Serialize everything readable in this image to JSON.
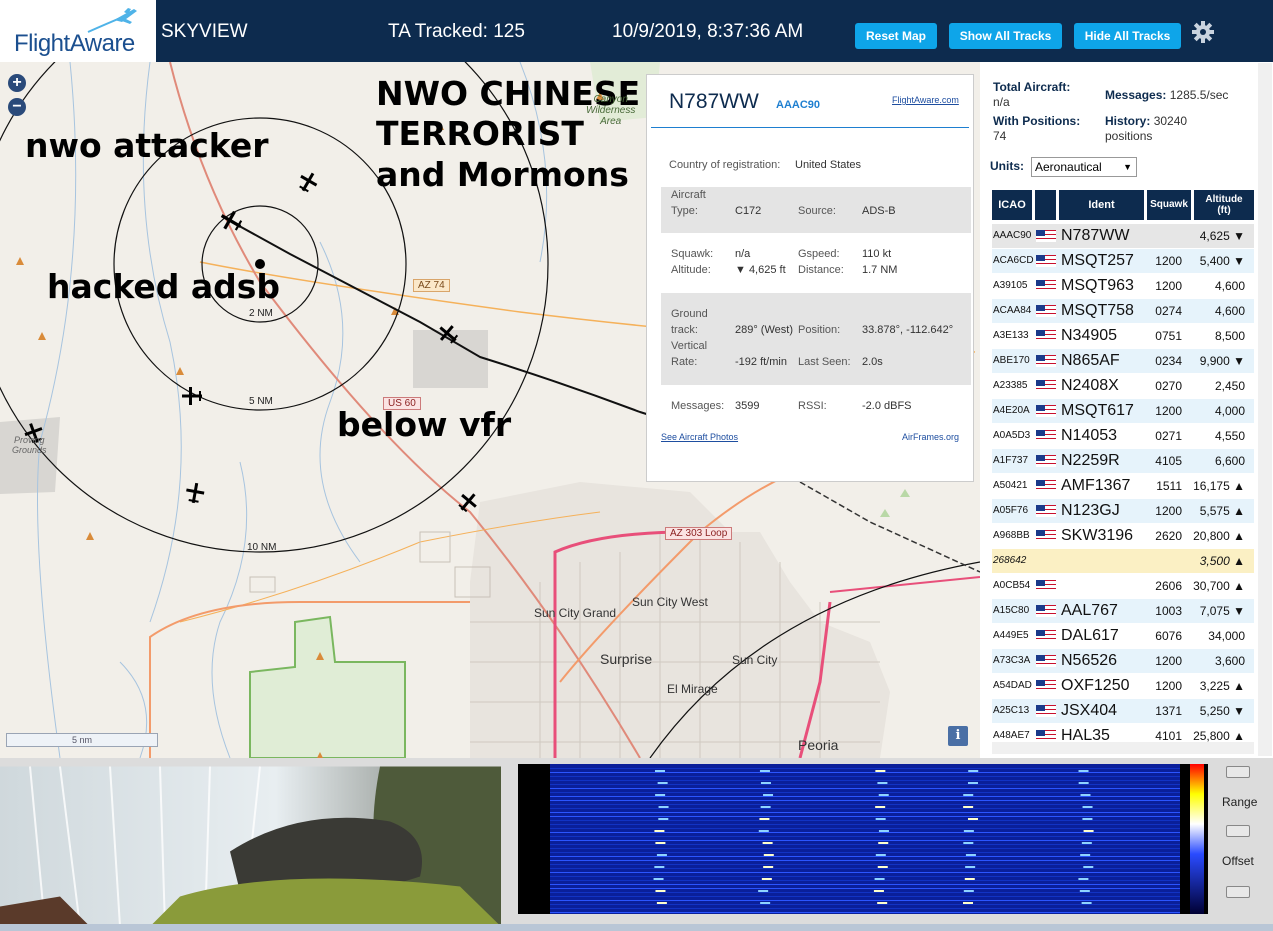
{
  "header": {
    "logo": "FlightAware",
    "title": "SKYVIEW",
    "tracked": "TA Tracked: 125",
    "datetime": "10/9/2019, 8:37:36 AM",
    "buttons": {
      "reset": "Reset Map",
      "show": "Show All Tracks",
      "hide": "Hide All Tracks"
    }
  },
  "map": {
    "zoom_in": "+",
    "zoom_out": "−",
    "annotations": {
      "attacker": "nwo attacker",
      "terrorist": "NWO CHINESE\nTERRORIST\nand Mormons",
      "hacked": "hacked adsb",
      "below": "below vfr"
    },
    "rings": [
      "2 NM",
      "5 NM",
      "10 NM"
    ],
    "places": {
      "wilderness": "Canyon\nWilderness\nArea",
      "proving": "Proving\nGrounds",
      "sun_city_grand": "Sun City Grand",
      "sun_city_west": "Sun City West",
      "surprise": "Surprise",
      "sun_city": "Sun City",
      "el_mirage": "El Mirage",
      "peoria": "Peoria"
    },
    "roads": {
      "az74": "AZ 74",
      "us60": "US 60",
      "az303": "AZ 303 Loop"
    },
    "scale": "5 nm",
    "info": "i"
  },
  "popup": {
    "registration": "N787WW",
    "icao": "AAAC90",
    "link": "FlightAware.com",
    "country_label": "Country of registration:",
    "country": "United States",
    "aircraft_label": "Aircraft",
    "type_label": "Type:",
    "type": "C172",
    "source_label": "Source:",
    "source": "ADS-B",
    "squawk_label": "Squawk:",
    "squawk": "n/a",
    "gspeed_label": "Gspeed:",
    "gspeed": "110 kt",
    "altitude_label": "Altitude:",
    "altitude": "▼ 4,625 ft",
    "distance_label": "Distance:",
    "distance": "1.7 NM",
    "ground_label": "Ground",
    "track_label": "track:",
    "track": "289° (West)",
    "position_label": "Position:",
    "position": "33.878°, -112.642°",
    "vertical_label": "Vertical",
    "rate_label": "Rate:",
    "rate": "-192 ft/min",
    "lastseen_label": "Last Seen:",
    "lastseen": "2.0s",
    "messages_label": "Messages:",
    "messages": "3599",
    "rssi_label": "RSSI:",
    "rssi": "-2.0 dBFS",
    "photos": "See Aircraft Photos",
    "airframes": "AirFrames.org"
  },
  "panel": {
    "total_label": "Total Aircraft:",
    "total": "n/a",
    "messages_label": "Messages:",
    "messages": "1285.5/sec",
    "withpos_label": "With Positions:",
    "withpos": "74",
    "history_label": "History:",
    "history": "30240",
    "history_unit": "positions",
    "units_label": "Units:",
    "units": "Aeronautical",
    "columns": {
      "icao": "ICAO",
      "ident": "Ident",
      "squawk": "Squawk",
      "alt1": "Altitude",
      "alt2": "(ft)"
    },
    "rows": [
      {
        "icao": "AAAC90",
        "ident": "N787WW",
        "squawk": "",
        "alt": "4,625 ▼",
        "flag": true
      },
      {
        "icao": "ACA6CD",
        "ident": "MSQT257",
        "squawk": "1200",
        "alt": "5,400 ▼",
        "flag": true
      },
      {
        "icao": "A39105",
        "ident": "MSQT963",
        "squawk": "1200",
        "alt": "4,600",
        "flag": true
      },
      {
        "icao": "ACAA84",
        "ident": "MSQT758",
        "squawk": "0274",
        "alt": "4,600",
        "flag": true
      },
      {
        "icao": "A3E133",
        "ident": "N34905",
        "squawk": "0751",
        "alt": "8,500",
        "flag": true
      },
      {
        "icao": "ABE170",
        "ident": "N865AF",
        "squawk": "0234",
        "alt": "9,900 ▼",
        "flag": true
      },
      {
        "icao": "A23385",
        "ident": "N2408X",
        "squawk": "0270",
        "alt": "2,450",
        "flag": true
      },
      {
        "icao": "A4E20A",
        "ident": "MSQT617",
        "squawk": "1200",
        "alt": "4,000",
        "flag": true
      },
      {
        "icao": "A0A5D3",
        "ident": "N14053",
        "squawk": "0271",
        "alt": "4,550",
        "flag": true
      },
      {
        "icao": "A1F737",
        "ident": "N2259R",
        "squawk": "4105",
        "alt": "6,600",
        "flag": true
      },
      {
        "icao": "A50421",
        "ident": "AMF1367",
        "squawk": "1511",
        "alt": "16,175 ▲",
        "flag": true
      },
      {
        "icao": "A05F76",
        "ident": "N123GJ",
        "squawk": "1200",
        "alt": "5,575 ▲",
        "flag": true
      },
      {
        "icao": "A968BB",
        "ident": "SKW3196",
        "squawk": "2620",
        "alt": "20,800 ▲",
        "flag": true
      },
      {
        "icao": "268642",
        "ident": "",
        "squawk": "",
        "alt": "3,500 ▲",
        "flag": false
      },
      {
        "icao": "A0CB54",
        "ident": "",
        "squawk": "2606",
        "alt": "30,700 ▲",
        "flag": true
      },
      {
        "icao": "A15C80",
        "ident": "AAL767",
        "squawk": "1003",
        "alt": "7,075 ▼",
        "flag": true
      },
      {
        "icao": "A449E5",
        "ident": "DAL617",
        "squawk": "6076",
        "alt": "34,000",
        "flag": true
      },
      {
        "icao": "A73C3A",
        "ident": "N56526",
        "squawk": "1200",
        "alt": "3,600",
        "flag": true
      },
      {
        "icao": "A54DAD",
        "ident": "OXF1250",
        "squawk": "1200",
        "alt": "3,225 ▲",
        "flag": true
      },
      {
        "icao": "A25C13",
        "ident": "JSX404",
        "squawk": "1371",
        "alt": "5,250 ▼",
        "flag": true
      },
      {
        "icao": "A48AE7",
        "ident": "HAL35",
        "squawk": "4101",
        "alt": "25,800 ▲",
        "flag": true
      }
    ]
  },
  "spectrum": {
    "range": "Range",
    "offset": "Offset"
  },
  "colors": {
    "header": "#0d2b4e",
    "button": "#0ea5e9",
    "row_selected": "#e6e6e6",
    "row_odd": "#e6f3fb",
    "row_highlight": "#fbf0c4"
  }
}
